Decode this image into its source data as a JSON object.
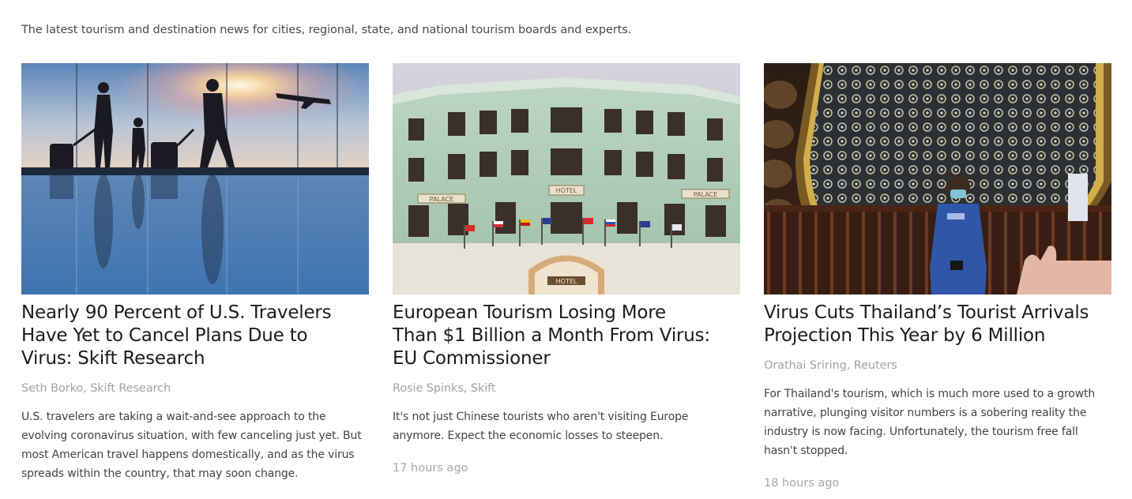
{
  "intro": "The latest tourism and destination news for cities, regional, state, and national tourism boards and experts.",
  "articles": [
    {
      "headline_lines": [
        "Nearly 90 Percent of U.S. Travelers",
        "Have Yet to Cancel Plans Due to",
        "Virus: Skift Research"
      ],
      "byline": "Seth Borko, Skift Research",
      "summary_lines": [
        "U.S. travelers are taking a wait-and-see approach to the",
        "evolving coronavirus situation, with few canceling just yet. But",
        "most American travel happens domestically, and as the virus",
        "spreads within the country, that may soon change."
      ],
      "timestamp": "",
      "image_icon": "airport-travelers-silhouette-image"
    },
    {
      "headline_lines": [
        "European Tourism Losing More",
        "Than $1 Billion a Month From Virus:",
        "EU Commissioner"
      ],
      "byline": "Rosie Spinks, Skift",
      "summary_lines": [
        "It's not just Chinese tourists who aren't visiting Europe",
        "anymore. Expect the economic losses to steepen."
      ],
      "timestamp": "17 hours ago",
      "image_icon": "palace-hotel-facade-image",
      "image_signs": [
        "HOTEL",
        "PALACE",
        "PALACE",
        "HOTEL"
      ]
    },
    {
      "headline_lines": [
        "Virus Cuts Thailand’s Tourist Arrivals",
        "Projection This Year by 6 Million"
      ],
      "byline": "Orathai Sriring, Reuters",
      "summary_lines": [
        "For Thailand's tourism, which is much more used to a growth",
        "narrative, plunging visitor numbers is a sobering reality the",
        "industry is now facing. Unfortunately, the tourism free fall",
        "hasn't stopped."
      ],
      "timestamp": "18 hours ago",
      "image_icon": "temple-visitor-masked-image"
    }
  ],
  "colors": {
    "headline": "#1c1c1c",
    "byline": "#a3a3a3",
    "body": "#444444"
  }
}
